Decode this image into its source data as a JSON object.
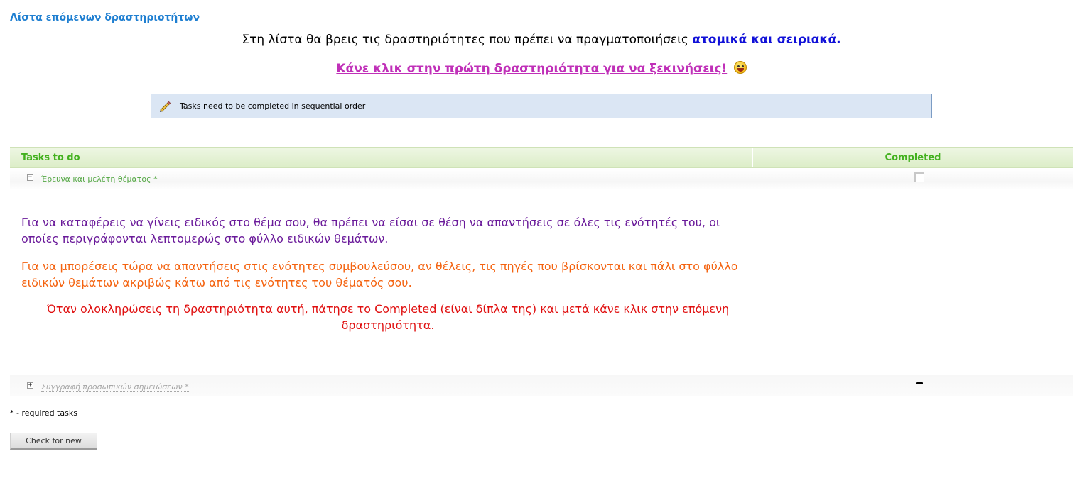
{
  "page_title": "Λίστα επόμενων δραστηριοτήτων",
  "intro": {
    "text": "Στη λίστα θα βρεις τις δραστηριότητες που πρέπει να πραγματοποιήσεις ",
    "highlight": "ατομικά και σειριακά."
  },
  "cta": {
    "text": "Κάνε κλικ στην πρώτη δραστηριότητα για να ξεκινήσεις!",
    "icon": "smiley-icon"
  },
  "notice": {
    "icon": "pencil-icon",
    "text": "Tasks need to be completed in sequential order"
  },
  "table": {
    "headers": {
      "tasks": "Tasks to do",
      "completed": "Completed"
    },
    "rows": [
      {
        "toggle": "−",
        "label": "Έρευνα και μελέτη θέματος *",
        "completed_checked": false,
        "expanded": true
      },
      {
        "toggle": "+",
        "label": "Συγγραφή προσωπικών σημειώσεων *",
        "expanded": false
      }
    ],
    "description": {
      "p1": "Για να καταφέρεις να γίνεις ειδικός στο θέμα σου, θα πρέπει να είσαι σε θέση να απαντήσεις σε όλες τις ενότητές του, οι οποίες περιγράφονται λεπτομερώς στο φύλλο ειδικών θεμάτων.",
      "p2": "Για να μπορέσεις τώρα να απαντήσεις στις ενότητες συμβουλεύσου, αν θέλεις, τις πηγές που βρίσκονται και πάλι στο φύλλο ειδικών θεμάτων ακριβώς κάτω από τις ενότητες του θέματός σου.",
      "p3": "Όταν ολοκληρώσεις τη δραστηριότητα αυτή, πάτησε το Completed (είναι δίπλα της) και μετά κάνε κλικ στην επόμενη δραστηριότητα."
    }
  },
  "legend": "* - required tasks",
  "check_button": "Check for new",
  "colors": {
    "title": "#1f7fd1",
    "header_text": "#43b11f",
    "highlight": "#1010d8",
    "cta": "#c030b8",
    "p1": "#6a1a9a",
    "p2": "#f46310",
    "p3": "#e01010"
  }
}
